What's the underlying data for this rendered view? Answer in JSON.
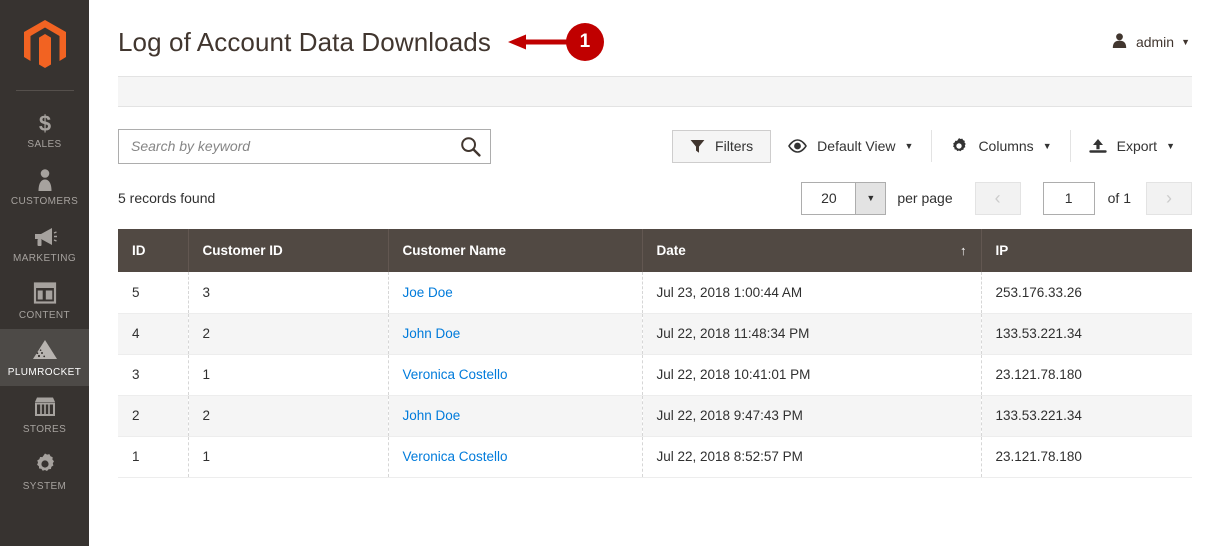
{
  "sidebar": {
    "logo_name": "magento-logo-icon",
    "items": [
      {
        "label": "SALES",
        "icon": "dollar-icon",
        "active": false
      },
      {
        "label": "CUSTOMERS",
        "icon": "person-icon",
        "active": false
      },
      {
        "label": "MARKETING",
        "icon": "megaphone-icon",
        "active": false
      },
      {
        "label": "CONTENT",
        "icon": "layout-icon",
        "active": false
      },
      {
        "label": "PLUMROCKET",
        "icon": "plumrocket-icon",
        "active": true
      },
      {
        "label": "STORES",
        "icon": "storefront-icon",
        "active": false
      },
      {
        "label": "SYSTEM",
        "icon": "gear-icon",
        "active": false
      }
    ]
  },
  "header": {
    "title": "Log of Account Data Downloads",
    "admin_label": "admin",
    "admin_caret": "▼",
    "annotation_badge": "1",
    "annotation_color": "#c00000"
  },
  "toolbar": {
    "search_placeholder": "Search by keyword",
    "search_value": "",
    "filters_label": "Filters",
    "view_label": "Default View",
    "columns_label": "Columns",
    "export_label": "Export",
    "caret": "▼"
  },
  "grid_controls": {
    "records_found": "5 records found",
    "per_page_value": "20",
    "per_page_label": "per page",
    "per_page_caret": "▼",
    "prev_arrow": "‹",
    "next_arrow": "›",
    "current_page": "1",
    "of_pages": "of 1"
  },
  "table": {
    "columns": [
      {
        "label": "ID",
        "sort": ""
      },
      {
        "label": "Customer ID",
        "sort": ""
      },
      {
        "label": "Customer Name",
        "sort": ""
      },
      {
        "label": "Date",
        "sort": "↑"
      },
      {
        "label": "IP",
        "sort": ""
      }
    ],
    "rows": [
      {
        "id": "5",
        "customer_id": "3",
        "customer_name": "Joe Doe",
        "date": "Jul 23, 2018 1:00:44 AM",
        "ip": "253.176.33.26"
      },
      {
        "id": "4",
        "customer_id": "2",
        "customer_name": "John Doe",
        "date": "Jul 22, 2018 11:48:34 PM",
        "ip": "133.53.221.34"
      },
      {
        "id": "3",
        "customer_id": "1",
        "customer_name": "Veronica Costello",
        "date": "Jul 22, 2018 10:41:01 PM",
        "ip": "23.121.78.180"
      },
      {
        "id": "2",
        "customer_id": "2",
        "customer_name": "John Doe",
        "date": "Jul 22, 2018 9:47:43 PM",
        "ip": "133.53.221.34"
      },
      {
        "id": "1",
        "customer_id": "1",
        "customer_name": "Veronica Costello",
        "date": "Jul 22, 2018 8:52:57 PM",
        "ip": "23.121.78.180"
      }
    ]
  },
  "colors": {
    "sidebar_bg": "#373330",
    "sidebar_active_bg": "#4d4a47",
    "accent_orange": "#f26322",
    "table_header_bg": "#514943",
    "link_blue": "#007bdb",
    "annotation_red": "#c00000"
  }
}
